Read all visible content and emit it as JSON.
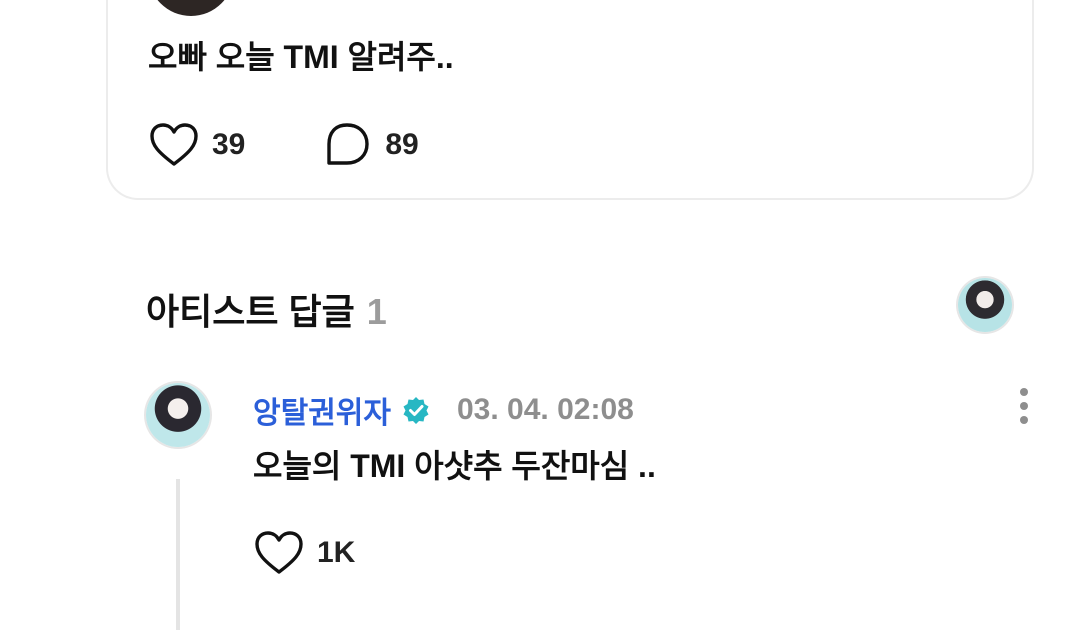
{
  "fan_post": {
    "author_name": "",
    "time": "",
    "text": "오빠 오늘 TMI 알려주..",
    "likes": "39",
    "comments": "89"
  },
  "artist_section": {
    "title": "아티스트 답글",
    "count": "1"
  },
  "artist_reply": {
    "author_name": "앙탈권위자",
    "time": "03. 04. 02:08",
    "text": "오늘의 TMI 아샷추 두잔마심 ..",
    "likes": "1K"
  },
  "icons": {
    "like": "heart-icon",
    "comment": "comment-bubble-icon",
    "verified": "verified-badge-icon",
    "more": "more-vertical-icon",
    "fan_badge": "membership-badge-icon"
  },
  "colors": {
    "accent": "#2b5fd9",
    "verified": "#27b7c3",
    "badge": "#7b5cff",
    "muted": "#8e8e8e"
  }
}
